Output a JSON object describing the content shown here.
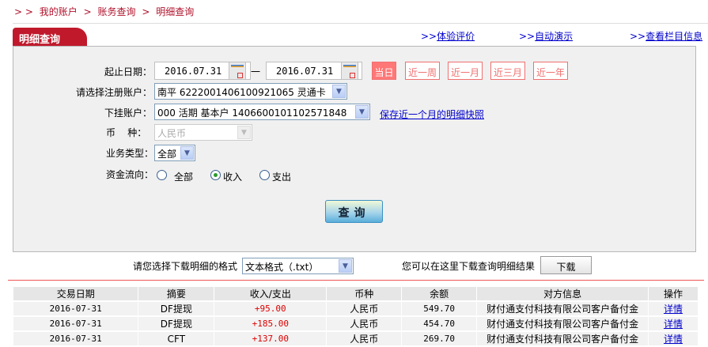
{
  "breadcrumb": {
    "sep": "> >",
    "items": [
      "我的账户",
      "账务查询",
      "明细查询"
    ]
  },
  "tab_title": "明细查询",
  "top_links": [
    {
      "prefix": ">>",
      "label": "体验评价"
    },
    {
      "prefix": ">>",
      "label": "自动演示"
    },
    {
      "prefix": ">>",
      "label": "查看栏目信息"
    }
  ],
  "form": {
    "date_label": "起止日期：",
    "date_from": "2016.07.31",
    "date_to": "2016.07.31",
    "date_dash": "一",
    "quick": [
      "当日",
      "近一周",
      "近一月",
      "近三月",
      "近一年"
    ],
    "quick_selected": "当日",
    "account_label": "请选择注册账户：",
    "account_value": "南平  6222001406100921065 灵通卡",
    "sub_label": "下挂账户：",
    "sub_value": "000 活期 基本户 1406600101102571848",
    "snapshot_link": "保存近一个月的明细快照",
    "currency_label": "币    种：",
    "currency_value": "人民币",
    "type_label": "业务类型：",
    "type_value": "全部",
    "flow_label": "资金流向：",
    "flow_options": [
      "全部",
      "收入",
      "支出"
    ],
    "flow_selected": "收入",
    "query_button": "查询"
  },
  "download": {
    "label": "请您选择下载明细的格式",
    "format": "文本格式（.txt）",
    "hint": "您可以在这里下载查询明细结果",
    "button": "下载"
  },
  "table": {
    "headers": [
      "交易日期",
      "摘要",
      "收入/支出",
      "币种",
      "余额",
      "对方信息",
      "操作"
    ],
    "rows": [
      [
        "2016-07-31",
        "DF提现",
        "+95.00",
        "人民币",
        "549.70",
        "财付通支付科技有限公司客户备付金",
        "详情"
      ],
      [
        "2016-07-31",
        "DF提现",
        "+185.00",
        "人民币",
        "454.70",
        "财付通支付科技有限公司客户备付金",
        "详情"
      ],
      [
        "2016-07-31",
        "CFT",
        "+137.00",
        "人民币",
        "269.70",
        "财付通支付科技有限公司客户备付金",
        "详情"
      ]
    ]
  },
  "colors": {
    "brand_red": "#c0192c",
    "quick_btn": "#f77777",
    "amount": "#dd0000",
    "link": "#0000cc"
  }
}
